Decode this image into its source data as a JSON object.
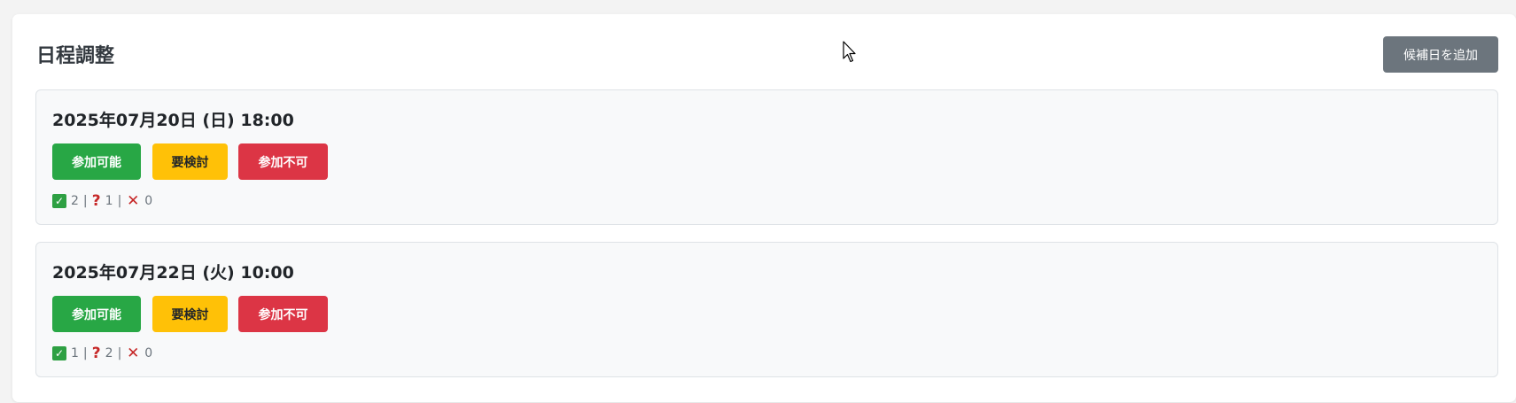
{
  "header": {
    "title": "日程調整",
    "add_button_label": "候補日を追加"
  },
  "slots": [
    {
      "datetime": "2025年07月20日 (日) 18:00",
      "buttons": {
        "available": "参加可能",
        "maybe": "要検討",
        "unavailable": "参加不可"
      },
      "counts": {
        "available": "2",
        "maybe": "1",
        "unavailable": "0"
      }
    },
    {
      "datetime": "2025年07月22日 (火) 10:00",
      "buttons": {
        "available": "参加可能",
        "maybe": "要検討",
        "unavailable": "参加不可"
      },
      "counts": {
        "available": "1",
        "maybe": "2",
        "unavailable": "0"
      }
    }
  ],
  "icons": {
    "available": "check-mark-icon",
    "maybe": "question-mark-icon",
    "unavailable": "cross-mark-icon",
    "pointer": "mouse-pointer-icon"
  },
  "colors": {
    "available": "#28a745",
    "maybe": "#ffc107",
    "unavailable": "#dc3545",
    "secondary": "#6c757d"
  }
}
